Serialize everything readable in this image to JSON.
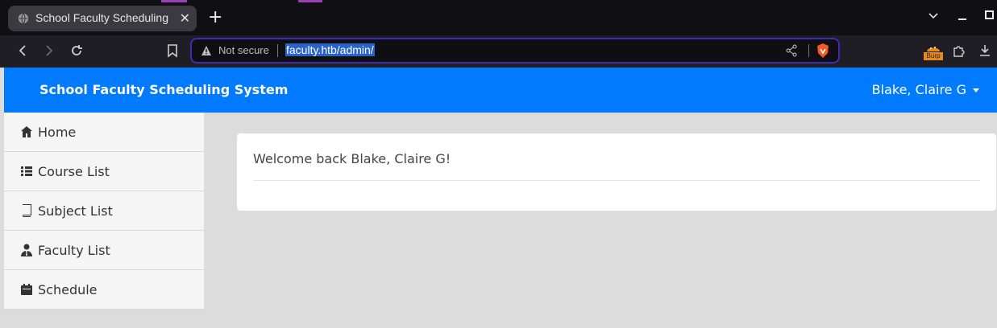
{
  "browser": {
    "tab_title": "School Faculty Scheduling",
    "tab_close": "✕",
    "new_tab": "+",
    "security_label": "Not secure",
    "url": "faculty.htb/admin/",
    "extension_label": "Burp"
  },
  "navbar": {
    "brand": "School Faculty Scheduling System",
    "user": "Blake, Claire G"
  },
  "sidebar": {
    "items": [
      {
        "label": "Home",
        "icon": "home-icon"
      },
      {
        "label": "Course List",
        "icon": "list-icon"
      },
      {
        "label": "Subject List",
        "icon": "book-icon"
      },
      {
        "label": "Faculty List",
        "icon": "user-tie-icon"
      },
      {
        "label": "Schedule",
        "icon": "calendar-icon"
      }
    ]
  },
  "main": {
    "welcome": "Welcome back Blake, Claire G!"
  },
  "colors": {
    "accent": "#007bff",
    "page_bg": "#dcdcdc",
    "sidebar_bg": "#f5f5f5"
  }
}
